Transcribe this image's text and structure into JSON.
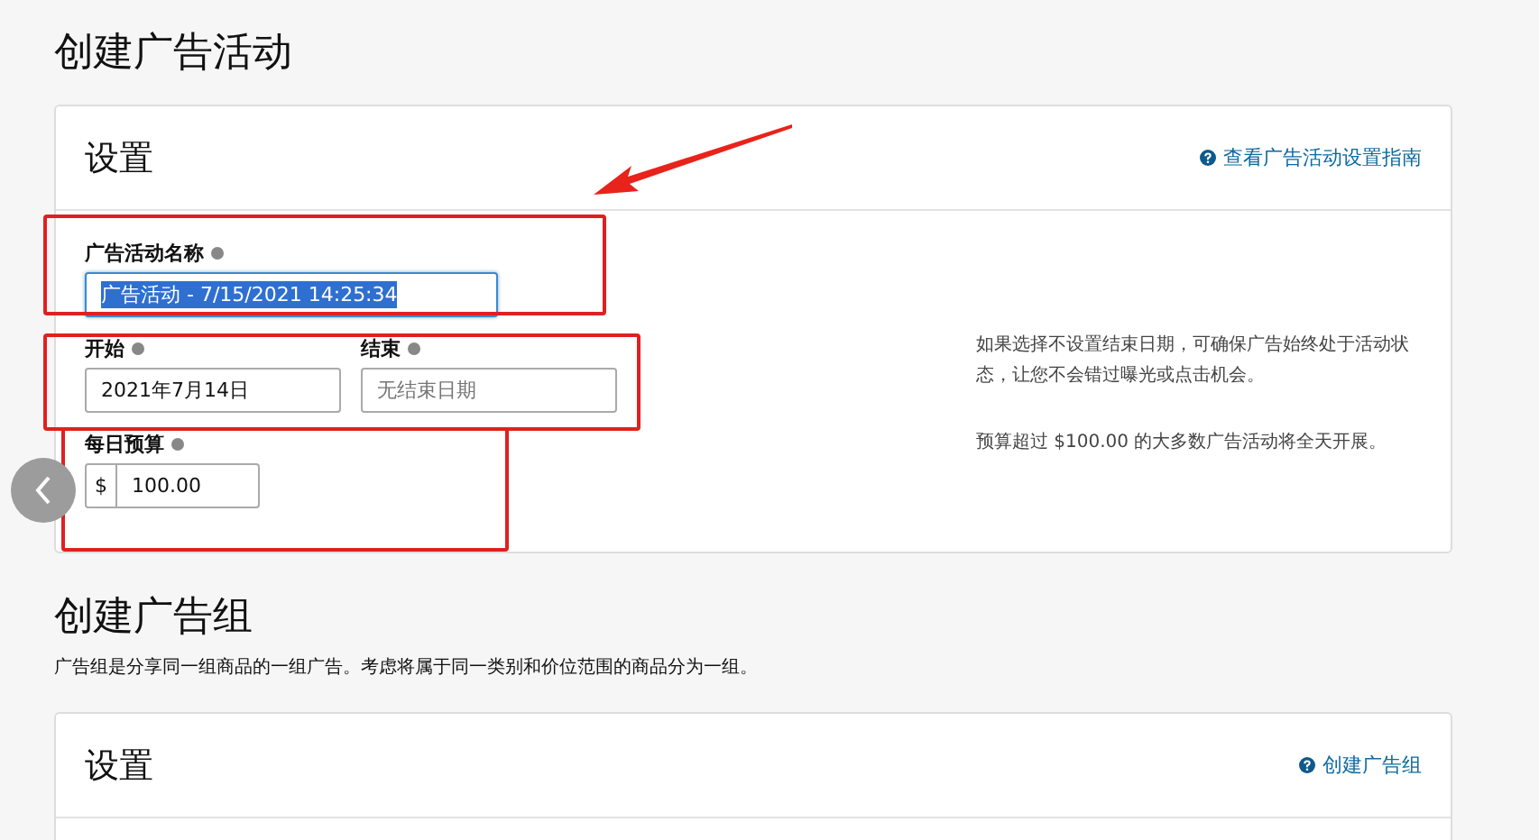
{
  "campaign": {
    "title": "创建广告活动",
    "card": {
      "heading": "设置",
      "help_link": "查看广告活动设置指南",
      "name_field": {
        "label": "广告活动名称",
        "value": "广告活动 - 7/15/2021 14:25:34",
        "text_selected": true
      },
      "start_field": {
        "label": "开始",
        "value": "2021年7月14日"
      },
      "end_field": {
        "label": "结束",
        "placeholder": "无结束日期"
      },
      "date_hint": "如果选择不设置结束日期，可确保广告始终处于活动状态，让您不会错过曝光或点击机会。",
      "budget_field": {
        "label": "每日预算",
        "prefix": "$",
        "value": "100.00"
      },
      "budget_hint": "预算超过 $100.00 的大多数广告活动将全天开展。"
    }
  },
  "ad_group": {
    "title": "创建广告组",
    "description": "广告组是分享同一组商品的一组广告。考虑将属于同一类别和价位范围的商品分为一组。",
    "card": {
      "heading": "设置",
      "help_link": "创建广告组"
    }
  }
}
